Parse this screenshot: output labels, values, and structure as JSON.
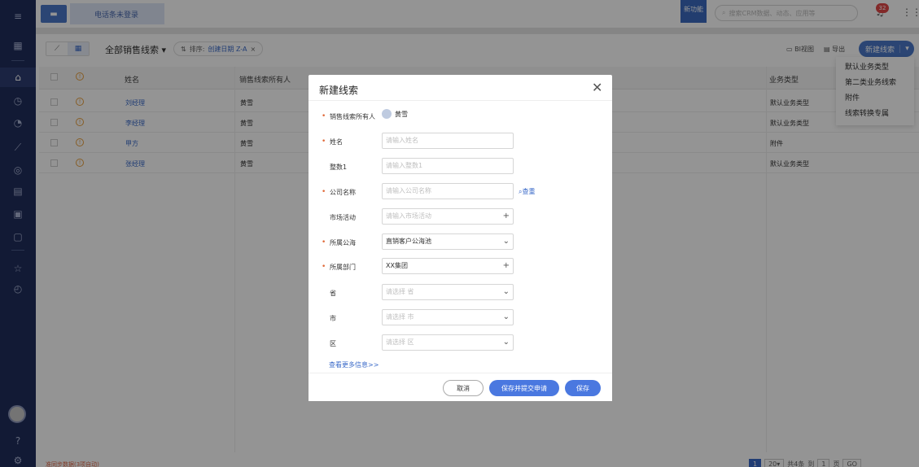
{
  "topbar": {
    "phone_status": "电话条未登录",
    "new_feature_badge": "新功能",
    "search_placeholder": "搜索CRM数据、动态、应用等",
    "notification_count": "32"
  },
  "toolbar": {
    "list_title": "全部销售线索",
    "sort_label": "排序:",
    "sort_value": "创建日期 Z-A",
    "bi_view": "BI视图",
    "export": "导出",
    "new_lead": "新建线索"
  },
  "new_lead_menu": [
    "默认业务类型",
    "第二类业务线索",
    "附件",
    "线索转换专属"
  ],
  "table": {
    "headers": {
      "name": "姓名",
      "owner": "销售线索所有人",
      "biz_type": "业务类型"
    },
    "rows": [
      {
        "name": "刘经理",
        "owner": "黄雪",
        "biz_type": "默认业务类型"
      },
      {
        "name": "李经理",
        "owner": "黄雪",
        "biz_type": "默认业务类型"
      },
      {
        "name": "甲方",
        "owner": "黄雪",
        "biz_type": "附件"
      },
      {
        "name": "张经理",
        "owner": "黄雪",
        "biz_type": "默认业务类型"
      }
    ]
  },
  "footer": {
    "note": "准同步数据(3项自动)",
    "page_current": "1",
    "page_size": "20",
    "total_label": "共4条",
    "goto_label": "到",
    "goto_value": "1",
    "page_unit": "页",
    "go": "GO"
  },
  "modal": {
    "title": "新建线索",
    "fields": {
      "owner_label": "销售线索所有人",
      "owner_value": "黄雪",
      "name_label": "姓名",
      "name_ph": "请输入姓名",
      "int_label": "整数1",
      "int_ph": "请输入整数1",
      "company_label": "公司名称",
      "company_ph": "请输入公司名称",
      "dup_check": "查重",
      "campaign_label": "市场活动",
      "campaign_ph": "请输入市场活动",
      "pool_label": "所属公海",
      "pool_value": "直销客户公海池",
      "dept_label": "所属部门",
      "dept_value": "XX集团",
      "prov_label": "省",
      "prov_ph": "请选择 省",
      "city_label": "市",
      "city_ph": "请选择 市",
      "dist_label": "区",
      "dist_ph": "请选择 区"
    },
    "more_info": "查看更多信息>>",
    "cancel": "取消",
    "save_submit": "保存并提交申请",
    "save": "保存"
  },
  "icons": {
    "menu": "hamburger-icon",
    "dashboard": "dashboard-icon",
    "home": "home-icon",
    "chart": "pie-chart-icon",
    "notification": "bell-icon",
    "apps": "grid-icon"
  }
}
